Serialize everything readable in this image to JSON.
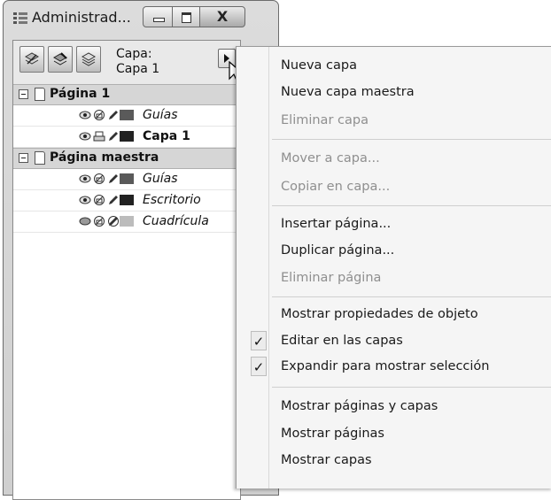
{
  "window": {
    "title": "Administrad...",
    "close_glyph": "X",
    "icons": [
      "layers-docker-icon",
      "minimize-icon",
      "maximize-icon",
      "close-icon"
    ]
  },
  "toolbar": {
    "tools": [
      "new-layer-icon",
      "edit-across-layers-icon",
      "layer-manager-view-icon"
    ],
    "current_layer_label": "Capa:",
    "current_layer_value": "Capa 1",
    "flyout_icon": "flyout-arrow-icon"
  },
  "tree": {
    "pages": [
      {
        "label": "Página 1",
        "layers": [
          {
            "label": "Guías",
            "color": "#5a5a5a",
            "bold": false
          },
          {
            "label": "Capa 1",
            "color": "#222222",
            "bold": true
          }
        ]
      },
      {
        "label": "Página maestra",
        "layers": [
          {
            "label": "Guías",
            "color": "#5a5a5a",
            "bold": false
          },
          {
            "label": "Escritorio",
            "color": "#222222",
            "bold": false
          },
          {
            "label": "Cuadrícula",
            "color": "#bcbcbc",
            "bold": false
          }
        ]
      }
    ],
    "icons": [
      "visibility-eye-icon",
      "printable-icon",
      "editable-pencil-icon"
    ]
  },
  "menu": {
    "items": [
      {
        "label": "Nueva capa",
        "enabled": true
      },
      {
        "label": "Nueva capa maestra",
        "enabled": true
      },
      {
        "label": "Eliminar capa",
        "enabled": false
      },
      {
        "label": "Mover a capa...",
        "enabled": false
      },
      {
        "label": "Copiar en capa...",
        "enabled": false
      },
      {
        "label": "Insertar página...",
        "enabled": true
      },
      {
        "label": "Duplicar página...",
        "enabled": true
      },
      {
        "label": "Eliminar página",
        "enabled": false
      },
      {
        "label": "Mostrar propiedades de objeto",
        "enabled": true
      },
      {
        "label": "Editar en las capas",
        "enabled": true,
        "checked": true
      },
      {
        "label": "Expandir para mostrar selección",
        "enabled": true,
        "checked": true
      },
      {
        "label": "Mostrar páginas y capas",
        "enabled": true
      },
      {
        "label": "Mostrar páginas",
        "enabled": true
      },
      {
        "label": "Mostrar capas",
        "enabled": true
      }
    ],
    "check_glyph": "✓"
  }
}
